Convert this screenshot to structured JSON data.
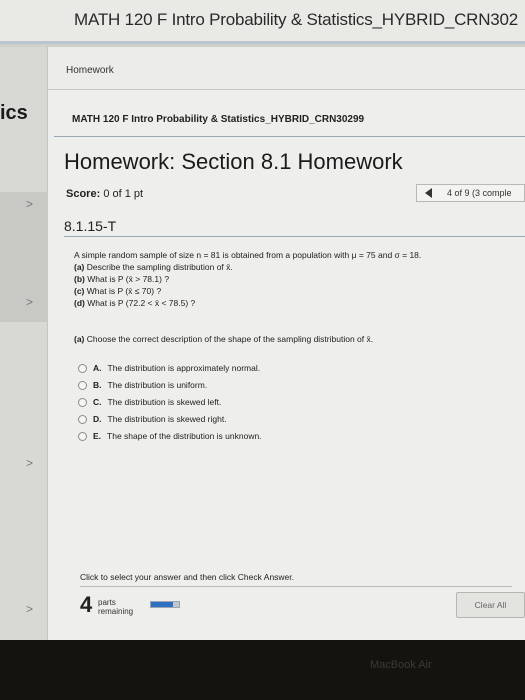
{
  "window": {
    "title": "MATH 120 F Intro Probability & Statistics_HYBRID_CRN302"
  },
  "sidebar": {
    "app_abbr": "ics",
    "chevron": ">"
  },
  "breadcrumb": {
    "label": "Homework"
  },
  "course": {
    "name": "MATH 120 F Intro Probability & Statistics_HYBRID_CRN30299"
  },
  "homework": {
    "title": "Homework: Section 8.1 Homework",
    "score_label": "Score:",
    "score_value": "0 of 1 pt",
    "question_position": "4 of 9 (3 comple",
    "question_id": "8.1.15-T"
  },
  "question": {
    "stem": "A simple random sample of size n = 81 is obtained from a population with μ = 75 and σ = 18.",
    "parts": [
      {
        "label": "(a)",
        "text": "Describe the sampling distribution of x̄."
      },
      {
        "label": "(b)",
        "text": "What is P (x̄ > 78.1) ?"
      },
      {
        "label": "(c)",
        "text": "What is P (x̄ ≤ 70) ?"
      },
      {
        "label": "(d)",
        "text": "What is P (72.2 < x̄ < 78.5) ?"
      }
    ],
    "subquestion_label": "(a)",
    "subquestion_text": "Choose the correct description of the shape of the sampling distribution of x̄.",
    "options": [
      {
        "letter": "A.",
        "text": "The distribution is approximately normal."
      },
      {
        "letter": "B.",
        "text": "The distribution is uniform."
      },
      {
        "letter": "C.",
        "text": "The distribution is skewed left."
      },
      {
        "letter": "D.",
        "text": "The distribution is skewed right."
      },
      {
        "letter": "E.",
        "text": "The shape of the distribution is unknown."
      }
    ],
    "instruction": "Click to select your answer and then click Check Answer."
  },
  "footer": {
    "parts_count": "4",
    "parts_label_1": "parts",
    "parts_label_2": "remaining",
    "progress_fraction": 0.8,
    "clear_label": "Clear All"
  },
  "device": {
    "brand": "MacBook Air"
  }
}
